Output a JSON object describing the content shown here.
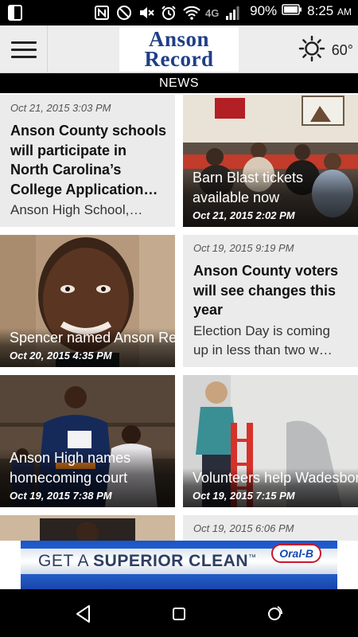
{
  "status_bar": {
    "battery": "90%",
    "time": "8:25",
    "ampm": "AM",
    "network": "4G",
    "icons": [
      "sim-card-icon",
      "nfc-icon",
      "do-not-disturb-icon",
      "mute-icon",
      "alarm-icon",
      "wifi-icon",
      "signal-icon",
      "battery-icon"
    ]
  },
  "header": {
    "logo_line1": "Anson",
    "logo_line2": "Record",
    "weather_icon": "sun-icon",
    "temperature": "60°"
  },
  "section": "NEWS",
  "articles": [
    {
      "kind": "text",
      "date": "Oct 21, 2015 3:03 PM",
      "headline": "Anson County schools will participate in North Carolina’s College Application…",
      "summary": "Anson High School,…"
    },
    {
      "kind": "image",
      "date": "Oct 21, 2015 2:02 PM",
      "headline": "Barn Blast tickets available now"
    },
    {
      "kind": "image",
      "date": "Oct 20, 2015 4:35 PM",
      "headline": "Spencer named Anson Record advertising di…"
    },
    {
      "kind": "text",
      "date": "Oct 19, 2015 9:19 PM",
      "headline": "Anson County voters will see changes this year",
      "summary1": "Election Day is coming",
      "summary2": "up in less than two w…"
    },
    {
      "kind": "image",
      "date": "Oct 19, 2015 7:38 PM",
      "headline": "Anson High names homecoming court"
    },
    {
      "kind": "image",
      "date": "Oct 19, 2015 7:15 PM",
      "headline": "Volunteers help Wadesboro residents…"
    },
    {
      "kind": "image-partial"
    },
    {
      "kind": "text",
      "date": "Oct 19, 2015 6:06 PM"
    }
  ],
  "ad": {
    "text_light": "GET A ",
    "text_bold": "SUPERIOR CLEAN",
    "trademark": "™",
    "brand": "Oral-B"
  },
  "nav": {
    "back": "back-icon",
    "home": "home-icon",
    "recents": "recents-icon"
  },
  "colors": {
    "brand_blue": "#1f3f87",
    "ad_blue": "#1a56c9",
    "tile_gray": "#ebebeb"
  }
}
